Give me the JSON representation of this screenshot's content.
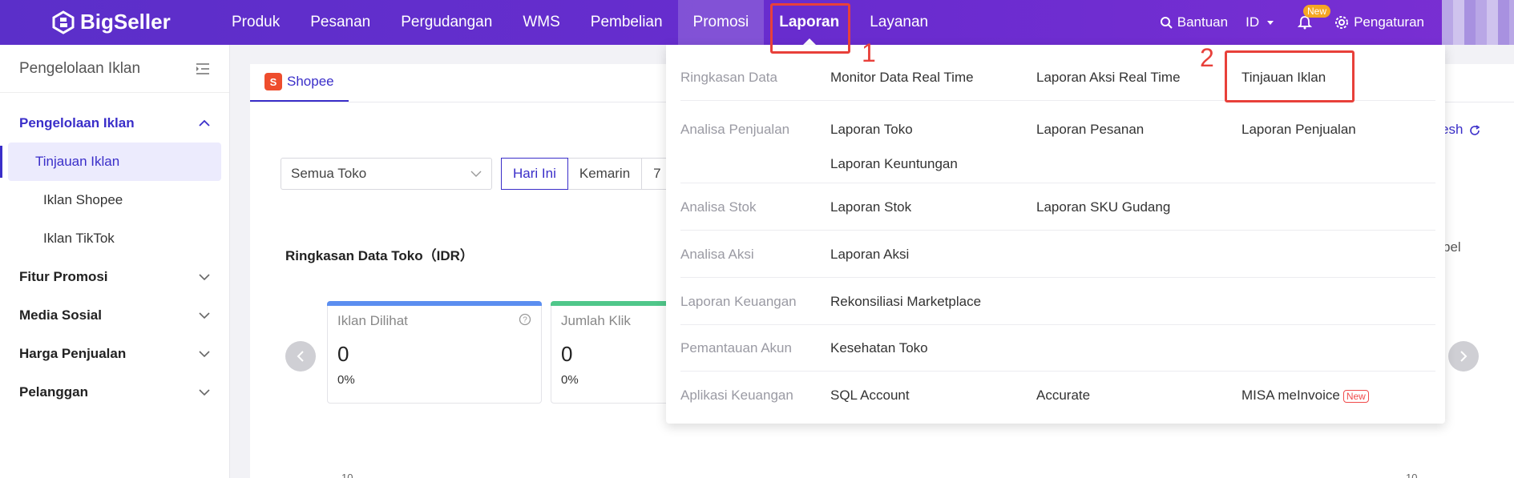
{
  "brand": {
    "name": "BigSeller"
  },
  "nav": {
    "items": [
      "Produk",
      "Pesanan",
      "Pergudangan",
      "WMS",
      "Pembelian",
      "Promosi",
      "Laporan",
      "Layanan"
    ],
    "help": "Bantuan",
    "lang": "ID",
    "new_badge": "New",
    "settings": "Pengaturan"
  },
  "sidebar": {
    "title": "Pengelolaan Iklan",
    "sections": [
      {
        "label": "Pengelolaan Iklan",
        "open": true,
        "items": [
          "Tinjauan Iklan",
          "Iklan Shopee",
          "Iklan TikTok"
        ]
      },
      {
        "label": "Fitur Promosi"
      },
      {
        "label": "Media Sosial"
      },
      {
        "label": "Harga Penjualan"
      },
      {
        "label": "Pelanggan"
      }
    ]
  },
  "main": {
    "tab": "Shopee",
    "tab_icon_letter": "S",
    "store_select": "Semua Toko",
    "date_buttons": [
      "Hari Ini",
      "Kemarin",
      "7"
    ],
    "summary_title": "Ringkasan Data Toko（IDR）",
    "cards": [
      {
        "label": "Iklan Dilihat",
        "value": "0",
        "pct": "0%"
      },
      {
        "label": "Jumlah Klik",
        "value": "0",
        "pct": "0%"
      }
    ],
    "fragments": {
      "refresh": "esh",
      "tabel": "bel",
      "axis_left": "10",
      "axis_right": "10"
    }
  },
  "dropdown": {
    "rows": [
      {
        "category": "Ringkasan Data",
        "links": [
          "Monitor Data Real Time",
          "Laporan Aksi Real Time",
          "Tinjauan Iklan"
        ]
      },
      {
        "category": "Analisa Penjualan",
        "links": [
          "Laporan Toko",
          "Laporan Pesanan",
          "Laporan Penjualan",
          "Laporan Keuntungan"
        ]
      },
      {
        "category": "Analisa Stok",
        "links": [
          "Laporan Stok",
          "Laporan SKU Gudang"
        ]
      },
      {
        "category": "Analisa Aksi",
        "links": [
          "Laporan Aksi"
        ]
      },
      {
        "category": "Laporan Keuangan",
        "links": [
          "Rekonsiliasi Marketplace"
        ]
      },
      {
        "category": "Pemantauan Akun",
        "links": [
          "Kesehatan Toko"
        ]
      },
      {
        "category": "Aplikasi Keuangan",
        "links": [
          "SQL Account",
          "Accurate",
          "MISA meInvoice"
        ],
        "new_tag": "New"
      }
    ]
  },
  "annotations": [
    "1",
    "2"
  ],
  "colors": {
    "primary": "#3a2ec9",
    "nav_bg": "#6a2ccf",
    "annotation": "#e8403a",
    "shopee": "#ee4d2d"
  }
}
